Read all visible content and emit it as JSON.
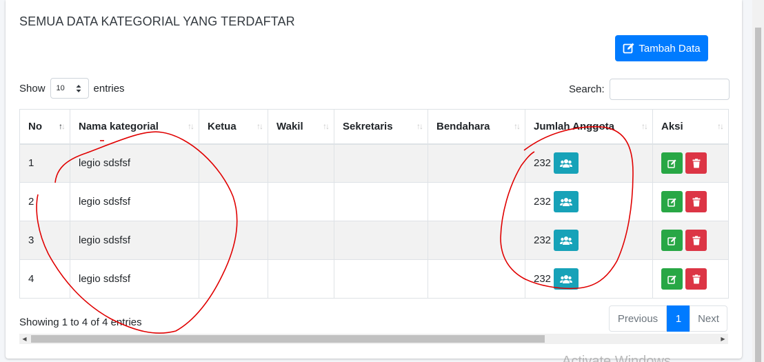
{
  "page": {
    "title": "SEMUA DATA KATEGORIAL YANG TERDAFTAR",
    "add_button_label": "Tambah Data"
  },
  "length_menu": {
    "show_label": "Show",
    "selected": "10",
    "entries_label": "entries"
  },
  "search": {
    "label": "Search:",
    "value": ""
  },
  "table": {
    "headers": [
      "No",
      "Nama kategorial",
      "Ketua",
      "Wakil",
      "Sekretaris",
      "Bendahara",
      "Jumlah Anggota",
      "Aksi"
    ],
    "rows": [
      {
        "no": "1",
        "nama": "legio sdsfsf",
        "ketua": "",
        "wakil": "",
        "sekretaris": "",
        "bendahara": "",
        "jumlah": "232"
      },
      {
        "no": "2",
        "nama": "legio sdsfsf",
        "ketua": "",
        "wakil": "",
        "sekretaris": "",
        "bendahara": "",
        "jumlah": "232"
      },
      {
        "no": "3",
        "nama": "legio sdsfsf",
        "ketua": "",
        "wakil": "",
        "sekretaris": "",
        "bendahara": "",
        "jumlah": "232"
      },
      {
        "no": "4",
        "nama": "legio sdsfsf",
        "ketua": "",
        "wakil": "",
        "sekretaris": "",
        "bendahara": "",
        "jumlah": "232"
      }
    ]
  },
  "footer": {
    "info": "Showing 1 to 4 of 4 entries",
    "prev_label": "Previous",
    "current_page": "1",
    "next_label": "Next"
  },
  "overlay": {
    "watermark": "Activate Windows"
  },
  "colors": {
    "primary": "#007bff",
    "info": "#17a2b8",
    "success": "#28a745",
    "danger": "#dc3545",
    "annotation": "#e00000"
  },
  "icons": {
    "add": "edit-icon",
    "members": "users-icon",
    "edit": "edit-icon",
    "delete": "trash-icon"
  }
}
